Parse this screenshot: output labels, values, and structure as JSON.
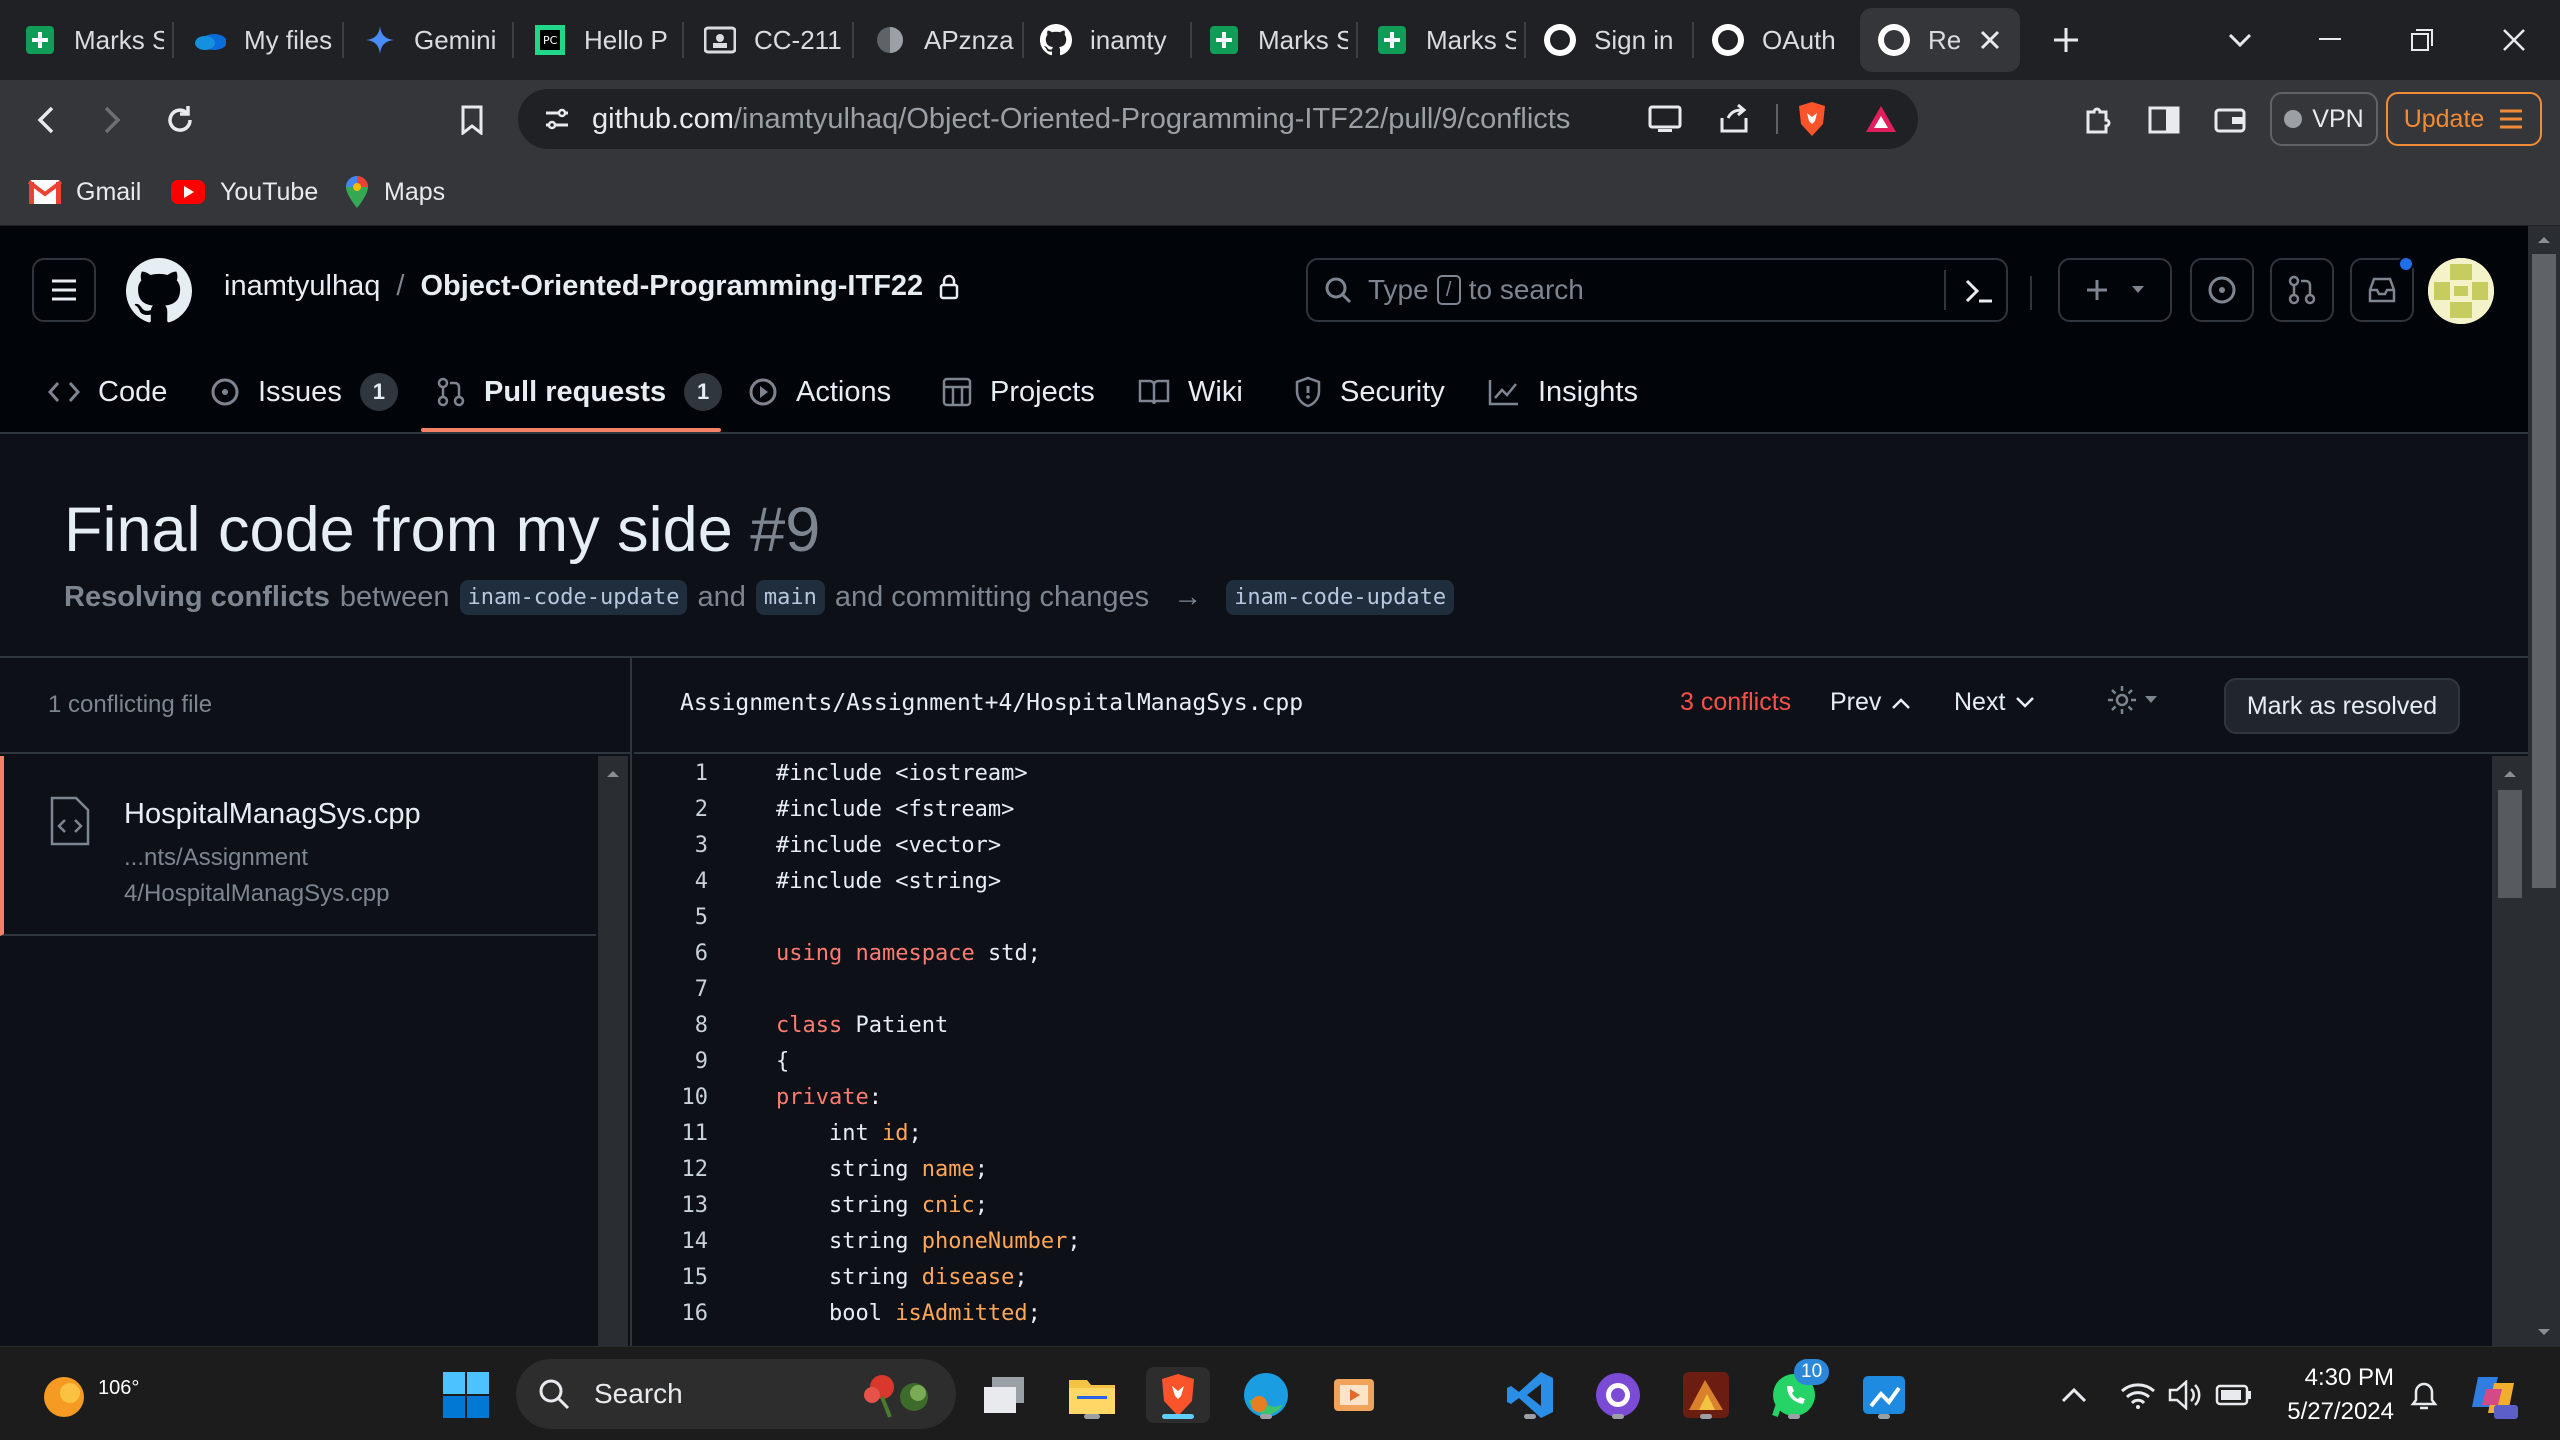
{
  "browser": {
    "tabs": [
      {
        "label": "Marks S",
        "icon": "sheets-icon"
      },
      {
        "label": "My files",
        "icon": "onedrive-icon"
      },
      {
        "label": "Gemini",
        "icon": "gemini-icon"
      },
      {
        "label": "Hello P",
        "icon": "pycharm-icon"
      },
      {
        "label": "CC-211",
        "icon": "classroom-icon"
      },
      {
        "label": "APznza",
        "icon": "globe-icon"
      },
      {
        "label": "inamty",
        "icon": "github-icon"
      },
      {
        "label": "Marks S",
        "icon": "sheets-icon"
      },
      {
        "label": "Marks S",
        "icon": "sheets-icon"
      },
      {
        "label": "Sign in",
        "icon": "github-icon"
      },
      {
        "label": "OAuth",
        "icon": "github-icon"
      },
      {
        "label": "Re",
        "icon": "github-icon"
      }
    ],
    "url_host": "github.com",
    "url_path": "/inamtyulhaq/Object-Oriented-Programming-ITF22/pull/9/conflicts",
    "vpn_label": "VPN",
    "update_label": "Update",
    "bookmarks": [
      {
        "label": "Gmail"
      },
      {
        "label": "YouTube"
      },
      {
        "label": "Maps"
      }
    ]
  },
  "github": {
    "owner": "inamtyulhaq",
    "separator": "/",
    "repo": "Object-Oriented-Programming-ITF22",
    "search_prefix": "Type",
    "search_key": "/",
    "search_suffix": "to search",
    "nav": [
      {
        "label": "Code"
      },
      {
        "label": "Issues",
        "count": "1"
      },
      {
        "label": "Pull requests",
        "count": "1"
      },
      {
        "label": "Actions"
      },
      {
        "label": "Projects"
      },
      {
        "label": "Wiki"
      },
      {
        "label": "Security"
      },
      {
        "label": "Insights"
      }
    ]
  },
  "pr": {
    "title": "Final code from my side",
    "number": "#9",
    "sub_strong": "Resolving conflicts",
    "sub_between": "between",
    "head_branch": "inam-code-update",
    "sub_and": "and",
    "base_branch": "main",
    "sub_committing": "and committing changes",
    "arrow": "→",
    "target_branch": "inam-code-update"
  },
  "conflict_panel": {
    "heading": "1 conflicting file",
    "file_name": "HospitalManagSys.cpp",
    "file_path_1": "...nts/Assignment",
    "file_path_2": "4/HospitalManagSys.cpp"
  },
  "editor": {
    "path": "Assignments/Assignment+4/HospitalManagSys.cpp",
    "conflicts": "3 conflicts",
    "prev": "Prev",
    "next": "Next",
    "resolve": "Mark as resolved",
    "line_numbers": [
      "1",
      "2",
      "3",
      "4",
      "5",
      "6",
      "7",
      "8",
      "9",
      "10",
      "11",
      "12",
      "13",
      "14",
      "15",
      "16"
    ],
    "lines": {
      "l1": "#include <iostream>",
      "l2": "#include <fstream>",
      "l3": "#include <vector>",
      "l4": "#include <string>",
      "l6_kw1": "using",
      "l6_kw2": "namespace",
      "l6_rest": " std;",
      "l8_kw": "class",
      "l8_rest": " Patient",
      "l9": "{",
      "l10_kw": "private",
      "l10_rest": ":",
      "l11_ty": "    int",
      "l11_id": " id",
      "l11_end": ";",
      "l12_ty": "    string",
      "l12_id": " name",
      "l12_end": ";",
      "l13_ty": "    string",
      "l13_id": " cnic",
      "l13_end": ";",
      "l14_ty": "    string",
      "l14_id": " phoneNumber",
      "l14_end": ";",
      "l15_ty": "    string",
      "l15_id": " disease",
      "l15_end": ";",
      "l16_ty": "    bool",
      "l16_id": " isAdmitted",
      "l16_end": ";"
    }
  },
  "taskbar": {
    "temperature": "106°",
    "search_label": "Search",
    "whatsapp_badge": "10",
    "time": "4:30 PM",
    "date": "5/27/2024"
  },
  "colors": {
    "accent_underline": "#f78166",
    "conflict_red": "#f85149",
    "keyword": "#ff7b72",
    "identifier": "#ffa657",
    "brave_orange": "#f28b36"
  }
}
